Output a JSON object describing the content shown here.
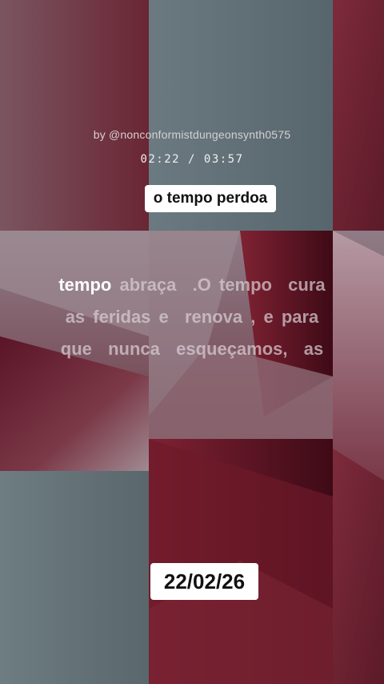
{
  "credit": "by @nonconformistdungeonsynth0575",
  "playback": {
    "current_time": "02:22",
    "separator": " / ",
    "total_time": "03:57"
  },
  "song_title": "o tempo perdoa",
  "lyrics": {
    "line1_active_word": "tempo",
    "line1_rest": " abraça  .O tempo  cura",
    "line2": "as feridas e  renova , e para",
    "line3": "que  nunca  esqueçamos,  as"
  },
  "date": "22/02/26",
  "colors": {
    "maroon": "#6b1e2c",
    "slate": "#5f6d72",
    "mauve": "#8a6a78"
  }
}
